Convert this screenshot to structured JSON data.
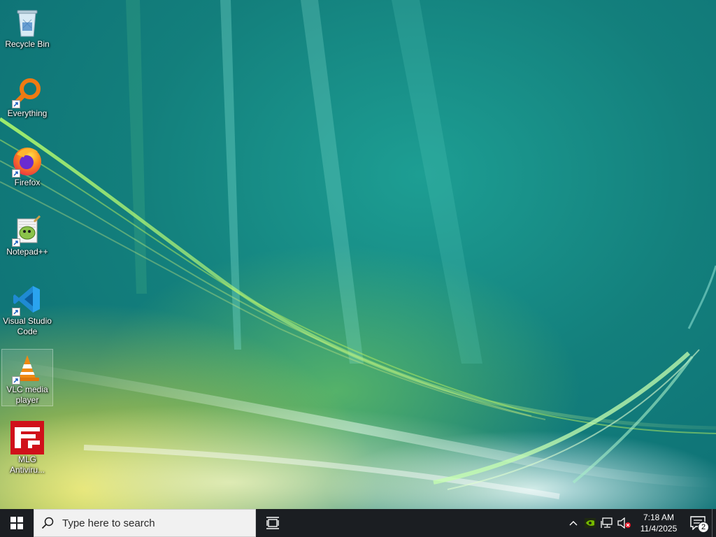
{
  "desktop": {
    "icons": [
      {
        "label": "Recycle Bin",
        "icon": "recycle-bin-icon",
        "shortcut": false
      },
      {
        "label": "Everything",
        "icon": "everything-search-icon",
        "shortcut": true
      },
      {
        "label": "Firefox",
        "icon": "firefox-icon",
        "shortcut": true
      },
      {
        "label": "Notepad++",
        "icon": "notepad-plus-plus-icon",
        "shortcut": true
      },
      {
        "label": "Visual Studio Code",
        "icon": "vscode-icon",
        "shortcut": true
      },
      {
        "label": "VLC media player",
        "icon": "vlc-icon",
        "shortcut": true
      },
      {
        "label": "MLG Antiviru...",
        "icon": "mlg-antivirus-icon",
        "shortcut": false
      }
    ],
    "selected_icon": "VLC media player"
  },
  "taskbar": {
    "search_placeholder": "Type here to search",
    "tray": {
      "time": "7:18 AM",
      "date": "11/4/2025",
      "notification_count": "2"
    }
  },
  "colors": {
    "taskbar_bg": "#1b1e22",
    "search_bg": "#f1f1f1",
    "accent_green": "#76b900"
  }
}
